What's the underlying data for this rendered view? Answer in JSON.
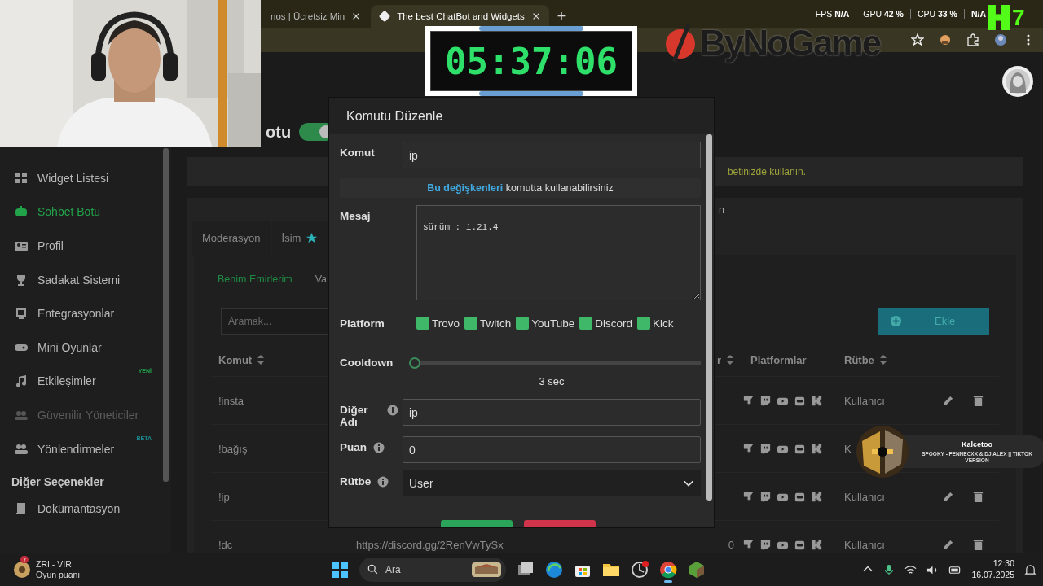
{
  "browser": {
    "tabs": [
      {
        "title": "nos | Ücretsiz Min",
        "selected": false
      },
      {
        "title": "The best ChatBot and Widgets",
        "selected": true
      }
    ],
    "new_tab": "+",
    "stats": [
      {
        "label": "FPS",
        "value": "N/A"
      },
      {
        "label": "GPU",
        "value": "42 %"
      },
      {
        "label": "CPU",
        "value": "33 %"
      }
    ],
    "stat_cut": "N/A"
  },
  "stream_overlay": {
    "timer": "05:37:06",
    "logo": "ByNoGame",
    "kick_count": "7"
  },
  "sidebar": {
    "items": [
      {
        "label": "Widget Listesi",
        "selected": false,
        "disabled": false
      },
      {
        "label": "Sohbet Botu",
        "selected": true,
        "disabled": false
      },
      {
        "label": "Profil",
        "selected": false,
        "disabled": false
      },
      {
        "label": "Sadakat Sistemi",
        "selected": false,
        "disabled": false
      },
      {
        "label": "Entegrasyonlar",
        "selected": false,
        "disabled": false
      },
      {
        "label": "Mini Oyunlar",
        "selected": false,
        "disabled": false
      },
      {
        "label": "Etkileşimler",
        "selected": false,
        "disabled": false,
        "badge": {
          "text": "YENİ",
          "color": "#22a34a"
        }
      },
      {
        "label": "Güvenilir Yöneticiler",
        "selected": false,
        "disabled": true
      },
      {
        "label": "Yönlendirmeler",
        "selected": false,
        "disabled": false,
        "badge": {
          "text": "BETA",
          "color": "#1b8a8f"
        }
      }
    ],
    "section": "Diğer Seçenekler",
    "section_items": [
      {
        "label": "Dokümantasyon",
        "selected": false,
        "disabled": false
      }
    ]
  },
  "page": {
    "title_fragment": "otu",
    "bot_enabled": true,
    "banner_fragment": "betinizde kullanın.",
    "panel_fragment": "n",
    "tabs": [
      {
        "label": "Moderasyon",
        "selected": false,
        "starred": false
      },
      {
        "label": "İsim",
        "selected": false,
        "starred": true
      }
    ],
    "subtabs": [
      {
        "label": "Benim Emirlerim",
        "selected": true
      },
      {
        "label": "Va",
        "selected": false
      }
    ],
    "search": {
      "placeholder": "Aramak..."
    },
    "add_button": "Ekle",
    "table": {
      "columns": {
        "command": "Komut",
        "column_3": "r",
        "platforms": "Platformlar",
        "rank": "Rütbe"
      },
      "rows": [
        {
          "command": "!insta",
          "rank": "Kullanıcı",
          "covered": false
        },
        {
          "command": "!bağış",
          "rank": "K",
          "covered": true
        },
        {
          "command": "!ip",
          "rank": "Kullanıcı",
          "covered": false
        },
        {
          "command": "!dc",
          "message": "https://discord.gg/2RenVwTySx",
          "column_3": "0",
          "rank": "Kullanıcı",
          "covered": false
        }
      ]
    }
  },
  "modal": {
    "title": "Komutu Düzenle",
    "command": {
      "label": "Komut",
      "value": "ip"
    },
    "hint": {
      "link": "Bu değişkenleri",
      "text": "komutta kullanabilirsiniz"
    },
    "message": {
      "label": "Mesaj",
      "value": "sürüm : 1.21.4"
    },
    "platform": {
      "label": "Platform",
      "options": [
        {
          "label": "Trovo",
          "checked": true
        },
        {
          "label": "Twitch",
          "checked": true
        },
        {
          "label": "YouTube",
          "checked": true
        },
        {
          "label": "Discord",
          "checked": true
        },
        {
          "label": "Kick",
          "checked": true
        }
      ]
    },
    "cooldown": {
      "label": "Cooldown",
      "level": 0,
      "reading": "3 sec"
    },
    "alias": {
      "label": "Diğer Adı",
      "value": "ip"
    },
    "points": {
      "label": "Puan",
      "value": "0"
    },
    "rank": {
      "label": "Rütbe",
      "value": "User"
    },
    "buttons": [
      {
        "kind": "confirm"
      },
      {
        "kind": "cancel"
      }
    ]
  },
  "music": {
    "artist": "Kalcetoo",
    "track": "SPOOKY - FENNECXX & DJ ALEX || TIKTOK VERSION"
  },
  "taskbar": {
    "widget": {
      "badge": "7",
      "title": "ZRI - VIR",
      "subtitle": "Oyun puanı"
    },
    "search": {
      "placeholder": "Ara"
    },
    "time": "12:30",
    "date": "16.07.2025"
  }
}
